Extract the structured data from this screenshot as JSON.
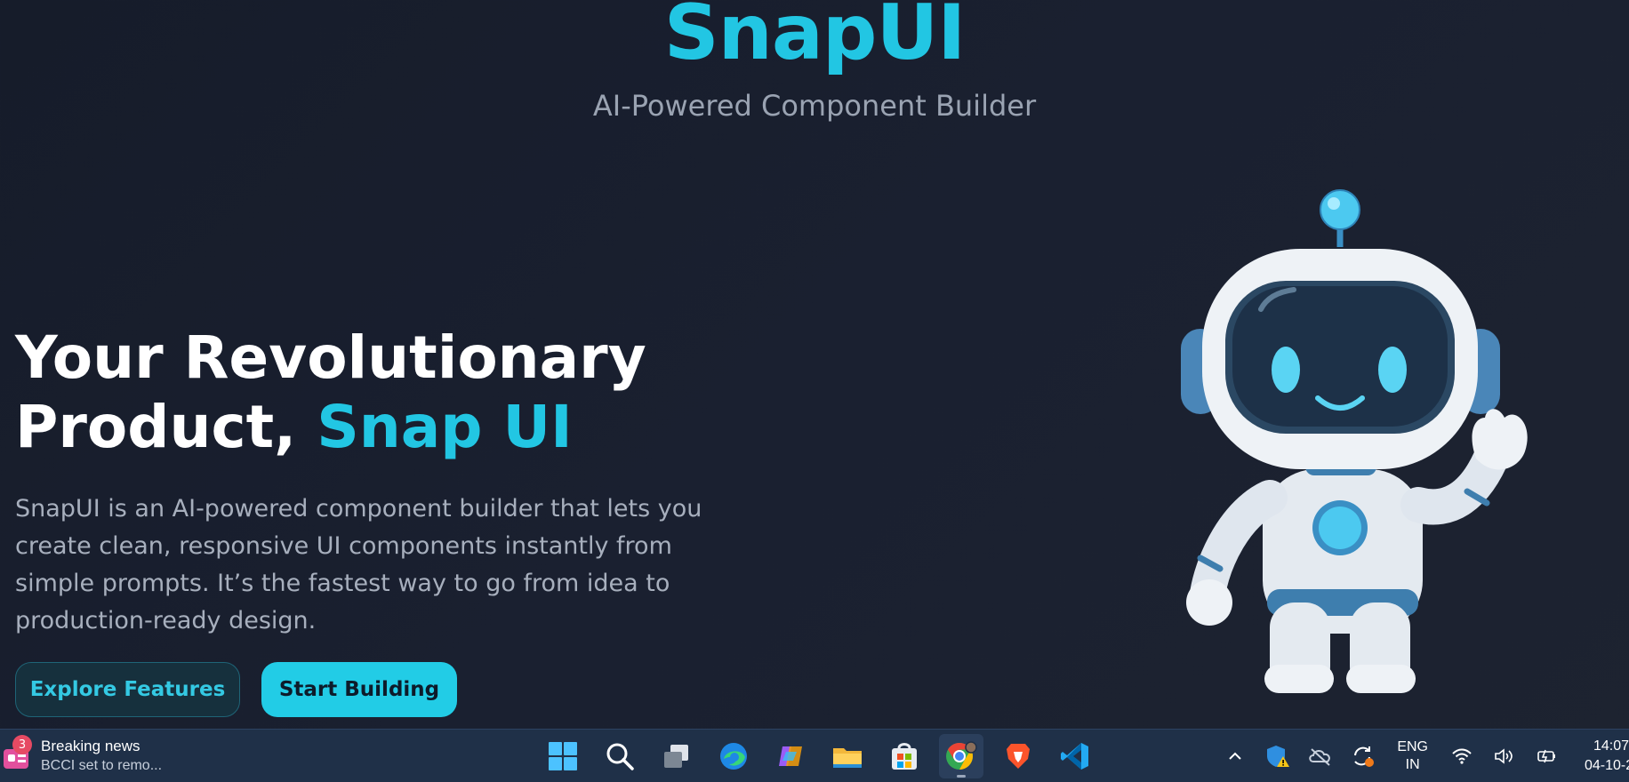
{
  "brand": {
    "title": "SnapUI",
    "subtitle": "AI-Powered Component Builder"
  },
  "hero": {
    "heading_line1": "Your Revolutionary",
    "heading_line2_plain": "Product, ",
    "heading_line2_accent": "Snap UI",
    "description": "SnapUI is an AI-powered component builder that lets you create clean, responsive UI components instantly from simple prompts. It’s the fastest way to go from idea to production-ready design."
  },
  "buttons": {
    "explore": "Explore Features",
    "start": "Start Building"
  },
  "colors": {
    "accent": "#22c6e3",
    "background": "#161c2a",
    "taskbar": "#1f3048"
  },
  "taskbar": {
    "news": {
      "badge": "3",
      "title": "Breaking news",
      "subtitle": "BCCI set to remo..."
    },
    "apps": [
      {
        "icon": "windows-start-icon"
      },
      {
        "icon": "search-icon"
      },
      {
        "icon": "task-view-icon"
      },
      {
        "icon": "edge-browser-icon"
      },
      {
        "icon": "copilot-icon"
      },
      {
        "icon": "file-explorer-icon"
      },
      {
        "icon": "microsoft-store-icon"
      },
      {
        "icon": "chrome-icon"
      },
      {
        "icon": "brave-browser-icon"
      },
      {
        "icon": "vscode-icon"
      }
    ],
    "tray": {
      "lang_line1": "ENG",
      "lang_line2": "IN",
      "time": "14:07",
      "date": "04-10-2"
    }
  }
}
